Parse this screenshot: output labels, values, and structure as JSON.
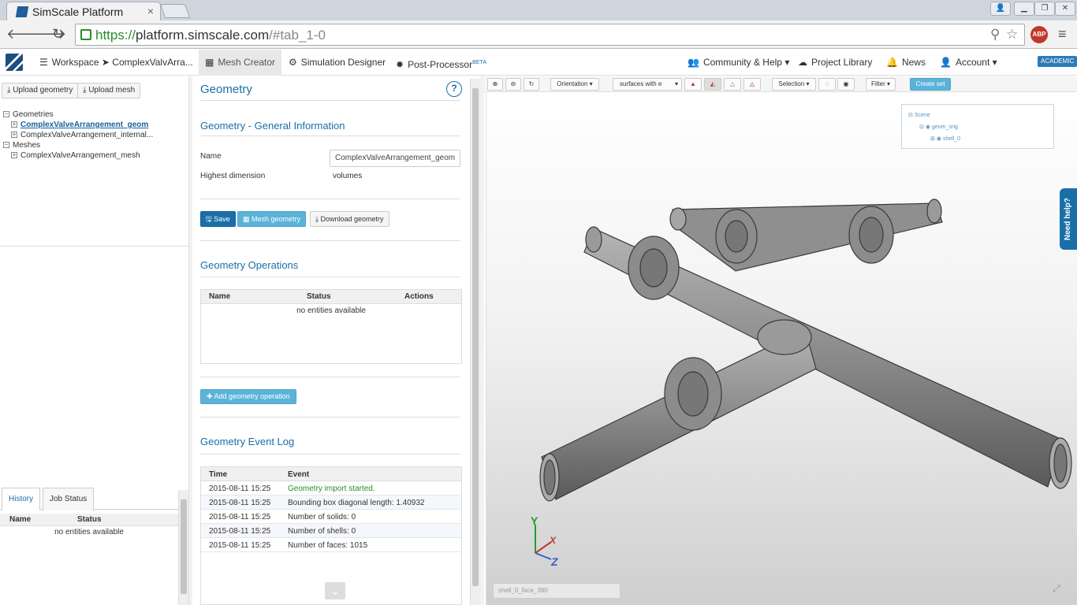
{
  "browser": {
    "tab_title": "SimScale Platform",
    "tab_close": "×",
    "url_protocol": "https://",
    "url_host": "platform.simscale.com",
    "url_path": "/#tab_1-0",
    "abp_label": "ABP"
  },
  "appnav": {
    "workspace": "Workspace ➤ ComplexValvArra...",
    "mesh_creator": "Mesh Creator",
    "simulation_designer": "Simulation Designer",
    "post_processor": "Post-Processor",
    "post_processor_badge": "BETA",
    "community": "Community & Help",
    "project_library": "Project Library",
    "news": "News",
    "account": "Account",
    "academic": "ACADEMIC"
  },
  "left": {
    "upload_geometry": "Upload geometry",
    "upload_mesh": "Upload mesh",
    "tree": {
      "geometries": "Geometries",
      "geom1": "ComplexValveArrangement_geom",
      "geom2": "ComplexValveArrangement_internal...",
      "meshes": "Meshes",
      "mesh1": "ComplexValveArrangement_mesh"
    },
    "tabs": {
      "history": "History",
      "job_status": "Job Status"
    },
    "table_headers": {
      "name": "Name",
      "status": "Status"
    },
    "no_entities": "no entities available"
  },
  "geometry": {
    "title": "Geometry",
    "help": "?",
    "general_info_title": "Geometry - General Information",
    "name_label": "Name",
    "name_value": "ComplexValveArrangement_geom",
    "highest_dim_label": "Highest dimension",
    "highest_dim_value": "volumes",
    "save": "Save",
    "mesh_geometry": "Mesh geometry",
    "download_geometry": "Download geometry",
    "operations_title": "Geometry Operations",
    "ops_headers": {
      "name": "Name",
      "status": "Status",
      "actions": "Actions"
    },
    "ops_empty": "no entities available",
    "add_operation": "Add geometry operation",
    "event_log_title": "Geometry Event Log",
    "log_headers": {
      "time": "Time",
      "event": "Event"
    },
    "log": [
      {
        "time": "2015-08-11 15:25",
        "event": "Geometry import started."
      },
      {
        "time": "2015-08-11 15:25",
        "event": "Bounding box diagonal length: 1.40932"
      },
      {
        "time": "2015-08-11 15:25",
        "event": "Number of solids: 0"
      },
      {
        "time": "2015-08-11 15:25",
        "event": "Number of shells: 0"
      },
      {
        "time": "2015-08-11 15:25",
        "event": "Number of faces: 1015"
      }
    ]
  },
  "viewer": {
    "orientation": "Orientation",
    "render_mode": "surfaces with e",
    "selection": "Selection",
    "filter": "Filter",
    "create_set": "Create set",
    "scene": "Scene",
    "geom_orig": "geom_orig",
    "shell": "shell_0",
    "face_readout": "shell_0_face_390",
    "need_help": "Need help?",
    "axis_x": "X",
    "axis_y": "Y",
    "axis_z": "Z"
  },
  "colors": {
    "brand": "#1a6fa8",
    "accent_light": "#5bb3d9",
    "success": "#2a8c2a"
  }
}
